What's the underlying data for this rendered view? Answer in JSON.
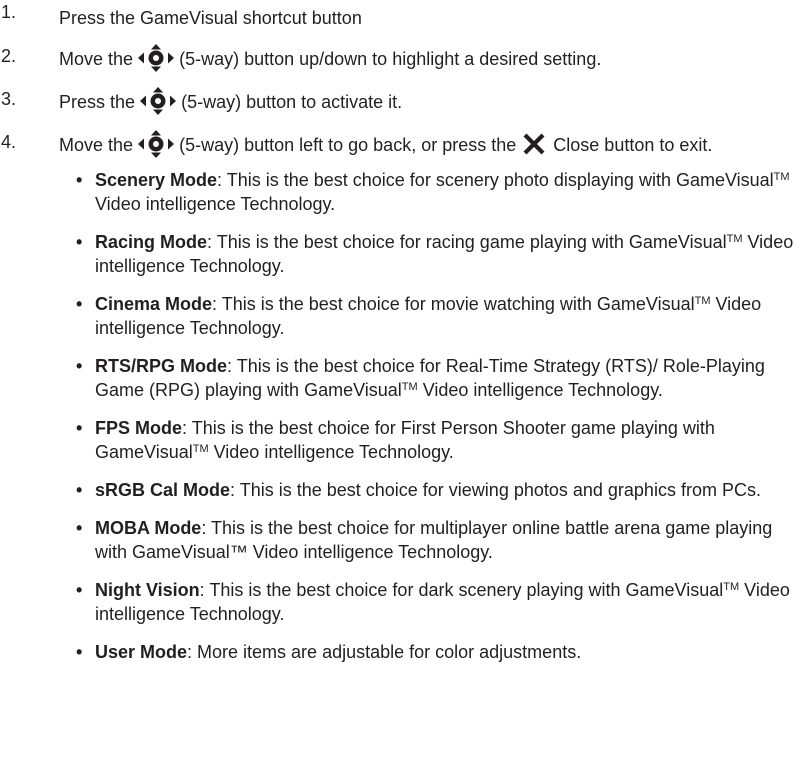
{
  "steps": [
    {
      "number": "1.",
      "text": "Press the GameVisual shortcut button"
    },
    {
      "number": "2.",
      "before": "Move the",
      "after": "(5-way) button up/down to highlight a desired setting."
    },
    {
      "number": "3.",
      "before": "Press the",
      "after": "(5-way) button to activate it."
    },
    {
      "number": "4.",
      "before": "Move the",
      "middle": "(5-way) button left to go back, or press the",
      "after": "Close button to exit."
    }
  ],
  "icons": {
    "five_way": "five-way-button-icon",
    "close": "close-x-icon"
  },
  "modes": [
    {
      "term": "Scenery Mode",
      "pre": ": This is the best choice for scenery photo displaying with GameVisual",
      "tm": "TM",
      "post": " Video intelligence Technology."
    },
    {
      "term": "Racing Mode",
      "pre": ": This is the best choice for racing game playing with GameVisual",
      "tm": "TM",
      "post": " Video intelligence Technology."
    },
    {
      "term": "Cinema Mode",
      "pre": ": This is the best choice for movie watching with GameVisual",
      "tm": "TM",
      "post": " Video intelligence Technology."
    },
    {
      "term": "RTS/RPG Mode",
      "pre": ": This is the best choice for Real-Time Strategy (RTS)/ Role-Playing Game (RPG) playing with GameVisual",
      "tm": "TM",
      "post": " Video intelligence Technology."
    },
    {
      "term": "FPS Mode",
      "pre": ": This is the best choice for First Person Shooter game playing with GameVisual",
      "tm": "TM",
      "post": " Video intelligence Technology."
    },
    {
      "term": "sRGB Cal Mode",
      "pre": ": This is the best choice for viewing photos and graphics from PCs.",
      "tm": "",
      "post": ""
    },
    {
      "term": "MOBA Mode",
      "pre": ": This is the best choice for multiplayer online battle arena game playing with GameVisual™ Video intelligence Technology.",
      "tm": "",
      "post": ""
    },
    {
      "term": "Night Vision",
      "pre": ": This is the best choice for dark scenery playing with GameVisual",
      "tm": "TM",
      "post": " Video intelligence Technology."
    },
    {
      "term": "User Mode",
      "pre": ": More items are adjustable for color adjustments.",
      "tm": "",
      "post": ""
    }
  ],
  "bullet_symbol": "•"
}
